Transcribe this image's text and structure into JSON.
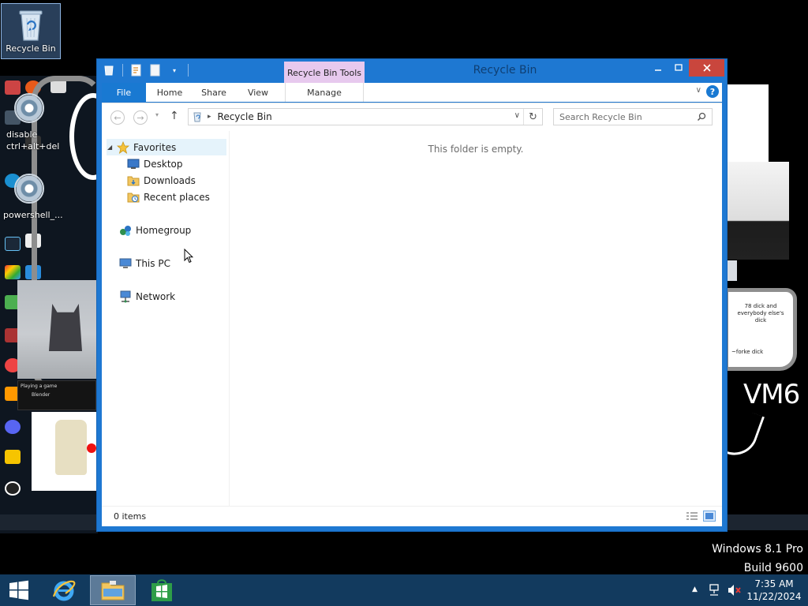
{
  "desktop": {
    "recycle_bin_icon_label": "Recycle Bin",
    "wallpaper_texts": {
      "disable_label": "disable\nctrl+alt+del",
      "powershell_label": "powershell_...",
      "note_text": "78 dick and everybody else's dick",
      "note_bottom": "~forke dick",
      "vm_label": "VM6",
      "popup_title": "Playing a game",
      "popup_app": "Blender"
    }
  },
  "window": {
    "title": "Recycle Bin",
    "context_tab_label": "Recycle Bin Tools",
    "ribbon_tabs": {
      "file": "File",
      "home": "Home",
      "share": "Share",
      "view": "View",
      "manage": "Manage"
    },
    "address": {
      "path": "Recycle Bin"
    },
    "search": {
      "placeholder": "Search Recycle Bin"
    },
    "nav_pane": {
      "favorites": "Favorites",
      "desktop": "Desktop",
      "downloads": "Downloads",
      "recent_places": "Recent places",
      "homegroup": "Homegroup",
      "this_pc": "This PC",
      "network": "Network"
    },
    "empty_message": "This folder is empty.",
    "status": {
      "item_count": "0 items"
    }
  },
  "watermark": {
    "line1": "Windows 8.1 Pro",
    "line2": "Build 9600"
  },
  "taskbar": {
    "time": "7:35 AM",
    "date": "11/22/2024"
  },
  "colors": {
    "window_frame": "#1e78d2",
    "context_tab": "#e7c9ee",
    "close_button": "#c9463d",
    "taskbar": "#123a5e",
    "file_tab": "#1979d2"
  },
  "icons": {
    "desktop_recycle_bin": "recycle-bin-icon",
    "qat": [
      "properties-icon",
      "new-folder-icon",
      "customize-qat-icon"
    ],
    "nav": [
      "back-arrow-icon",
      "forward-arrow-icon",
      "up-arrow-icon",
      "refresh-icon",
      "search-icon"
    ],
    "nav_pane": [
      "star-icon",
      "desktop-icon",
      "downloads-folder-icon",
      "recent-places-icon",
      "homegroup-icon",
      "computer-icon",
      "network-icon"
    ],
    "taskbar": [
      "windows-logo-icon",
      "internet-explorer-icon",
      "file-explorer-icon",
      "store-icon",
      "network-tray-icon",
      "muted-volume-icon"
    ]
  }
}
